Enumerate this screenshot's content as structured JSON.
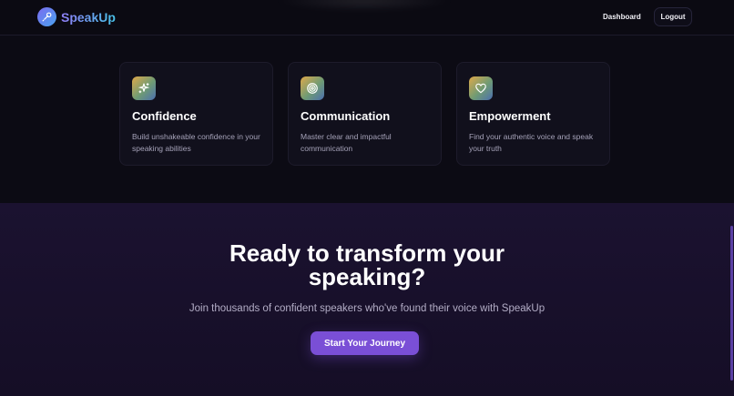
{
  "header": {
    "brand": "SpeakUp",
    "nav_dashboard": "Dashboard",
    "logout_label": "Logout"
  },
  "features": [
    {
      "icon": "sparkles-icon",
      "title": "Confidence",
      "description": "Build unshakeable confidence in your speaking abilities"
    },
    {
      "icon": "target-icon",
      "title": "Communication",
      "description": "Master clear and impactful communication"
    },
    {
      "icon": "heart-icon",
      "title": "Empowerment",
      "description": "Find your authentic voice and speak your truth"
    }
  ],
  "cta": {
    "title_line1": "Ready to transform your",
    "title_line2": "speaking?",
    "subtitle": "Join thousands of confident speakers who've found their voice with SpeakUp",
    "button_label": "Start Your Journey"
  },
  "colors": {
    "accent": "#7a4fd6",
    "background": "#0c0b14",
    "cta_background": "#1b1230"
  }
}
